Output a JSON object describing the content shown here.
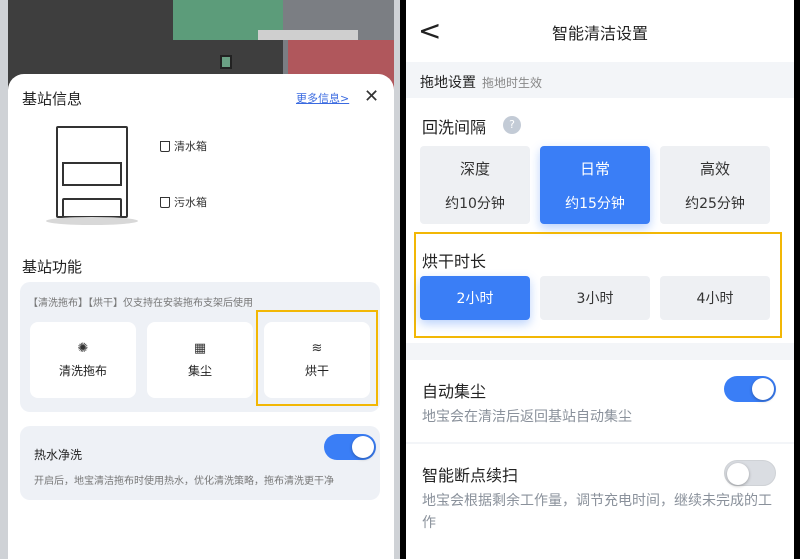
{
  "left": {
    "title": "基站信息",
    "more_link": "更多信息>",
    "close": "✕",
    "clean_tank": "清水箱",
    "dirty_tank": "污水箱",
    "functions_title": "基站功能",
    "note": "【清洗拖布】【烘干】仅支持在安装拖布支架后使用",
    "functions": [
      {
        "label": "清洗拖布",
        "icon": "✺"
      },
      {
        "label": "集尘",
        "icon": "▦"
      },
      {
        "label": "烘干",
        "icon": "≋"
      }
    ],
    "hot_water": {
      "title": "热水净洗",
      "desc": "开启后，地宝清洁拖布时使用热水，优化清洗策略，拖布清洗更干净",
      "on": true
    }
  },
  "right": {
    "back": "<",
    "title": "智能清洁设置",
    "section": "拖地设置",
    "section_note": "拖地时生效",
    "rewash_title": "回洗间隔",
    "help": "?",
    "rewash_options": [
      {
        "label": "深度",
        "time": "约10分钟"
      },
      {
        "label": "日常",
        "time": "约15分钟",
        "selected": true
      },
      {
        "label": "高效",
        "time": "约25分钟"
      }
    ],
    "dry_title": "烘干时长",
    "dry_options": [
      {
        "label": "2小时",
        "selected": true
      },
      {
        "label": "3小时"
      },
      {
        "label": "4小时"
      }
    ],
    "auto_dust": {
      "title": "自动集尘",
      "desc": "地宝会在清洁后返回基站自动集尘",
      "on": true
    },
    "resume": {
      "title": "智能断点续扫",
      "desc": "地宝会根据剩余工作量，调节充电时间，继续未完成的工作",
      "on": false
    }
  },
  "colors": {
    "accent": "#3a7ef6",
    "highlight": "#f2b705"
  }
}
